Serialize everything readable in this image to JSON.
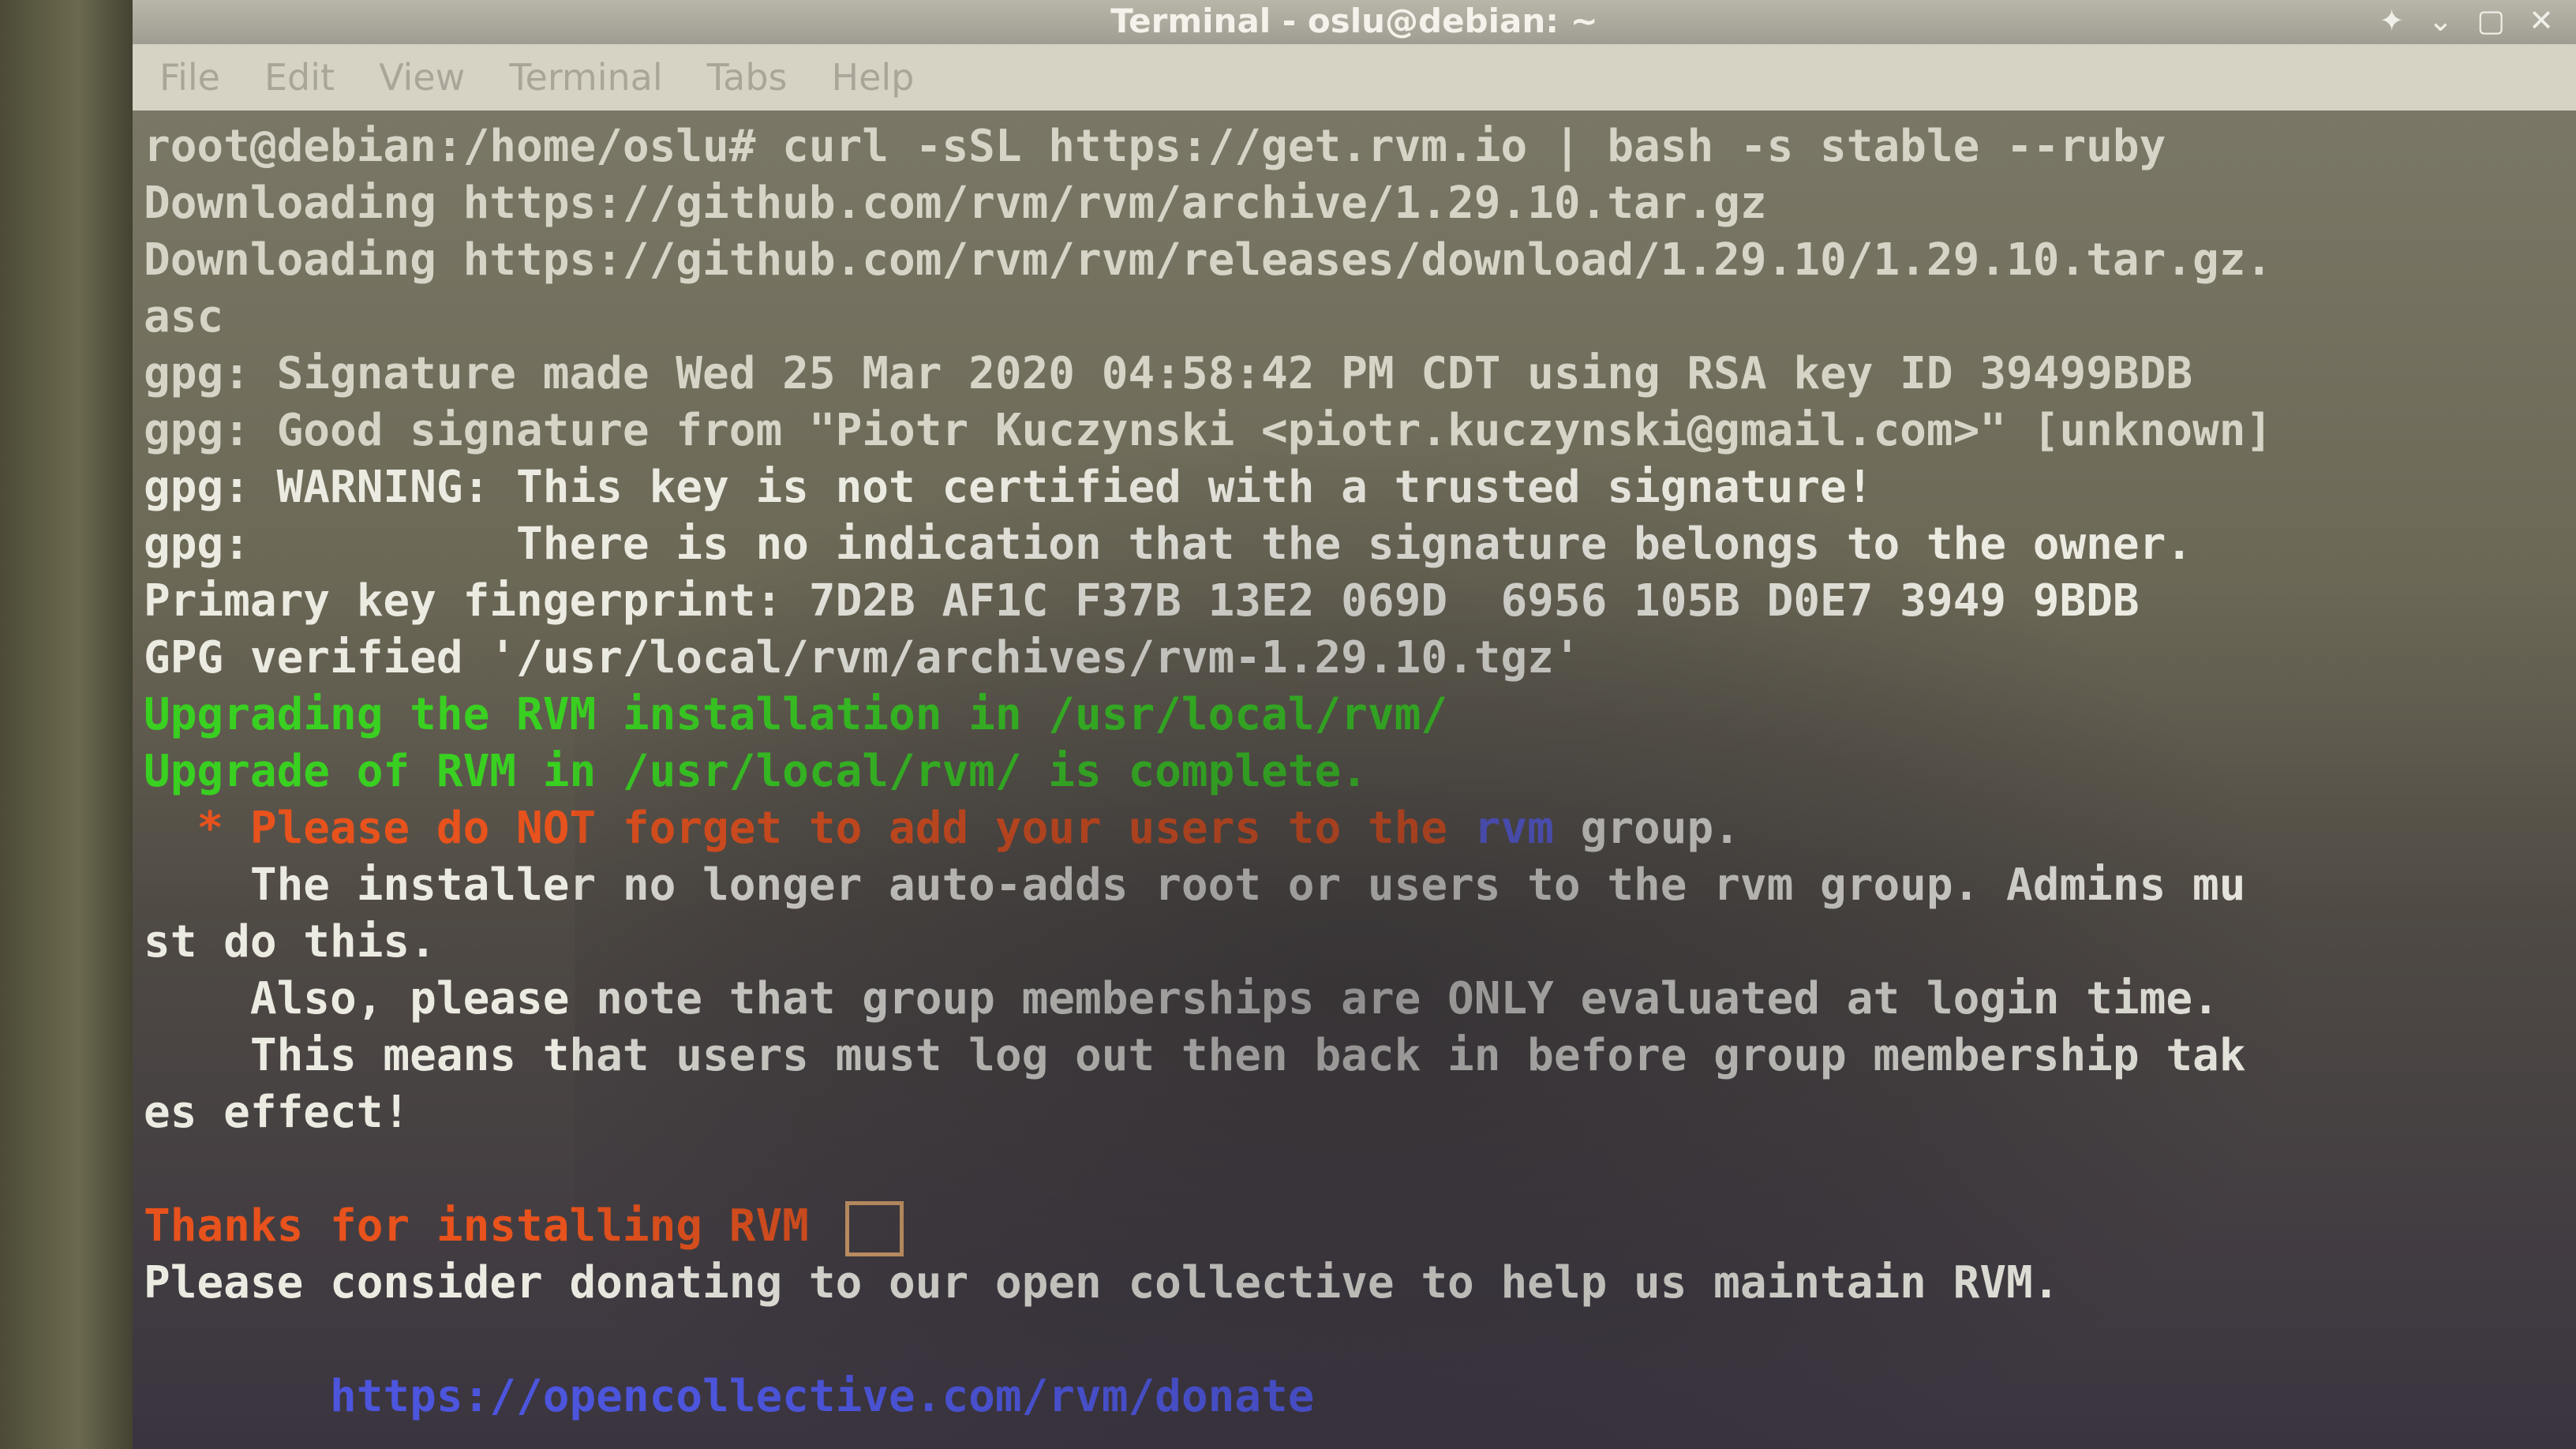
{
  "window": {
    "title": "Terminal - oslu@debian: ~",
    "controls": {
      "pin": "✦",
      "minimize": "⌄",
      "maximize": "▢",
      "close": "✕"
    }
  },
  "menu": {
    "items": [
      {
        "label": "File"
      },
      {
        "label": "Edit"
      },
      {
        "label": "View"
      },
      {
        "label": "Terminal"
      },
      {
        "label": "Tabs"
      },
      {
        "label": "Help"
      }
    ]
  },
  "terminal": {
    "lines": [
      {
        "segments": [
          {
            "text": "root@debian:/home/oslu# curl -sSL https://get.rvm.io | bash -s stable --ruby",
            "color": "grey"
          }
        ]
      },
      {
        "segments": [
          {
            "text": "Downloading https://github.com/rvm/rvm/archive/1.29.10.tar.gz",
            "color": "grey"
          }
        ]
      },
      {
        "segments": [
          {
            "text": "Downloading https://github.com/rvm/rvm/releases/download/1.29.10/1.29.10.tar.gz.",
            "color": "grey"
          }
        ]
      },
      {
        "segments": [
          {
            "text": "asc",
            "color": "grey"
          }
        ]
      },
      {
        "segments": [
          {
            "text": "gpg: Signature made Wed 25 Mar 2020 04:58:42 PM CDT using RSA key ID 39499BDB",
            "color": "grey"
          }
        ]
      },
      {
        "segments": [
          {
            "text": "gpg: Good signature from \"Piotr Kuczynski <piotr.kuczynski@gmail.com>\" [unknown]",
            "color": "grey"
          }
        ]
      },
      {
        "segments": [
          {
            "text": "gpg: WARNING: This key is not certified with a trusted signature!",
            "color": "white"
          }
        ]
      },
      {
        "segments": [
          {
            "text": "gpg:          There is no indication that the signature belongs to the owner.",
            "color": "white"
          }
        ]
      },
      {
        "segments": [
          {
            "text": "Primary key fingerprint: 7D2B AF1C F37B 13E2 069D  6956 105B D0E7 3949 9BDB",
            "color": "white"
          }
        ]
      },
      {
        "segments": [
          {
            "text": "GPG verified '/usr/local/rvm/archives/rvm-1.29.10.tgz'",
            "color": "white"
          }
        ]
      },
      {
        "segments": [
          {
            "text": "Upgrading the RVM installation in /usr/local/rvm/",
            "color": "green"
          }
        ]
      },
      {
        "segments": [
          {
            "text": "Upgrade of RVM in /usr/local/rvm/ is complete.",
            "color": "green"
          }
        ]
      },
      {
        "segments": [
          {
            "text": "  * Please do NOT forget to add your users to the ",
            "color": "red"
          },
          {
            "text": "rvm",
            "color": "blue"
          },
          {
            "text": " group.",
            "color": "white"
          }
        ]
      },
      {
        "segments": [
          {
            "text": "    The installer no longer auto-adds root or users to the rvm group. Admins mu",
            "color": "white"
          }
        ]
      },
      {
        "segments": [
          {
            "text": "st do this.",
            "color": "white"
          }
        ]
      },
      {
        "segments": [
          {
            "text": "    Also, please note that group memberships are ONLY evaluated at login time.",
            "color": "white"
          }
        ]
      },
      {
        "segments": [
          {
            "text": "    This means that users must log out then back in before group membership tak",
            "color": "white"
          }
        ]
      },
      {
        "segments": [
          {
            "text": "es effect!",
            "color": "white"
          }
        ]
      },
      {
        "segments": [
          {
            "text": "",
            "color": "white"
          }
        ]
      },
      {
        "segments": [
          {
            "text": "Thanks for installing RVM",
            "color": "red"
          },
          {
            "text": " ",
            "color": "white"
          }
        ],
        "trailing_box": true
      },
      {
        "segments": [
          {
            "text": "Please consider donating to our open collective to help us maintain RVM.",
            "color": "white"
          }
        ]
      },
      {
        "segments": [
          {
            "text": "",
            "color": "white"
          }
        ]
      },
      {
        "segments": [
          {
            "text": "       https://opencollective.com/rvm/donate",
            "color": "link"
          }
        ]
      }
    ]
  },
  "colors": {
    "grey": "#d6d4c6",
    "white": "#ecebe2",
    "green": "#39d021",
    "red": "#e8521c",
    "blue": "#5b61e6",
    "link": "#4c55dc"
  }
}
